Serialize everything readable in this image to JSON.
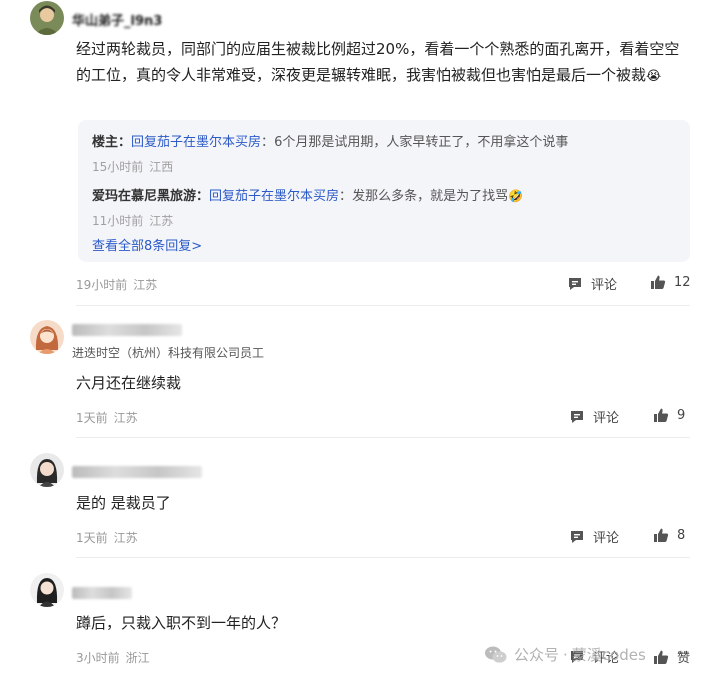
{
  "comments": [
    {
      "author": "华山弟子_l9n3",
      "text": "经过两轮裁员，同部门的应届生被裁比例超过20%，看着一个个熟悉的面孔离开，看着空空的工位，真的令人非常难受，深夜更是辗转难眠，我害怕被裁但也害怕是最后一个被裁",
      "emoji": "😭",
      "time": "19小时前",
      "location": "江苏",
      "comment_label": "评论",
      "likes": "12",
      "replies": [
        {
          "author": "楼主",
          "reply_prefix": "回复茄子在墨尔本买房",
          "text": "6个月那是试用期，人家早转正了，不用拿这个说事",
          "time": "15小时前",
          "location": "江西"
        },
        {
          "author": "爱玛在慕尼黑旅游",
          "reply_prefix": "回复茄子在墨尔本买房",
          "text": "发那么多条，就是为了找骂",
          "emoji": "🤣",
          "time": "11小时前",
          "location": "江苏"
        }
      ],
      "view_all": "查看全部8条回复>"
    },
    {
      "subtitle": "进迭时空（杭州）科技有限公司员工",
      "text": "六月还在继续裁",
      "time": "1天前",
      "location": "江苏",
      "comment_label": "评论",
      "likes": "9"
    },
    {
      "text": "是的 是裁员了",
      "time": "1天前",
      "location": "江苏",
      "comment_label": "评论",
      "likes": "8"
    },
    {
      "text": "蹲后，只裁入职不到一年的人？",
      "time": "3小时前",
      "location": "浙江",
      "comment_label": "评论",
      "likes_label": "赞"
    }
  ],
  "watermark": {
    "label": "公众号",
    "separator": "·",
    "name": "蒙溪codes"
  },
  "colors": {
    "link": "#2c5ac7",
    "reply_bg": "#f4f5f9",
    "meta": "#999999"
  }
}
